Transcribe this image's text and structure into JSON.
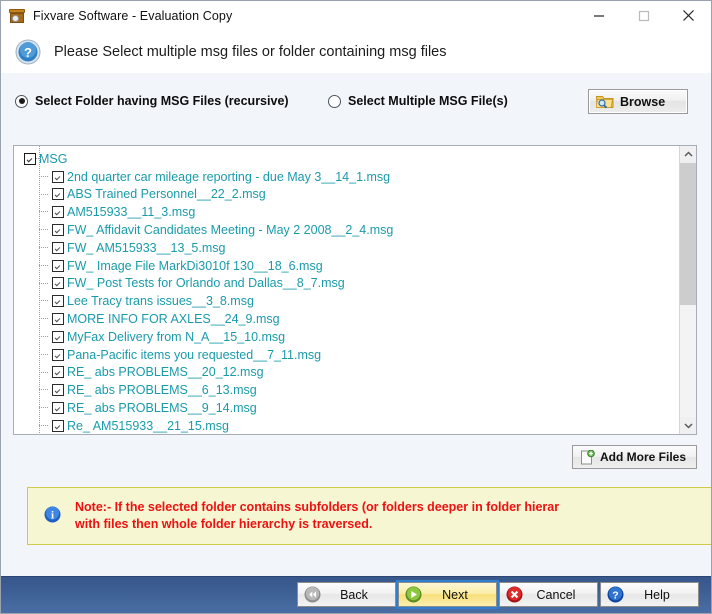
{
  "window": {
    "title": "Fixvare Software - Evaluation Copy",
    "app_icon": "trashcan-icon",
    "controls": {
      "minimize": "minimize-icon",
      "maximize": "maximize-icon",
      "close": "close-icon"
    }
  },
  "header": {
    "icon": "question-help-icon",
    "text": "Please Select multiple msg files or folder containing msg files"
  },
  "options": {
    "folder_radio": {
      "label": "Select Folder having MSG Files (recursive)",
      "selected": true
    },
    "files_radio": {
      "label": "Select Multiple MSG File(s)",
      "selected": false
    },
    "browse_button": {
      "label": "Browse",
      "icon": "folder-search-icon"
    }
  },
  "tree": {
    "root": {
      "label": "MSG",
      "checked": true,
      "expanded": true
    },
    "items": [
      {
        "label": "2nd quarter car mileage reporting - due May 3__14_1.msg",
        "checked": true
      },
      {
        "label": "ABS Trained Personnel__22_2.msg",
        "checked": true
      },
      {
        "label": "AM515933__11_3.msg",
        "checked": true
      },
      {
        "label": "FW_ Affidavit Candidates Meeting - May 2 2008__2_4.msg",
        "checked": true
      },
      {
        "label": "FW_ AM515933__13_5.msg",
        "checked": true
      },
      {
        "label": "FW_ Image File MarkDi3010f 130__18_6.msg",
        "checked": true
      },
      {
        "label": "FW_ Post Tests for Orlando and Dallas__8_7.msg",
        "checked": true
      },
      {
        "label": "Lee Tracy trans issues__3_8.msg",
        "checked": true
      },
      {
        "label": "MORE INFO FOR AXLES__24_9.msg",
        "checked": true
      },
      {
        "label": "MyFax Delivery from N_A__15_10.msg",
        "checked": true
      },
      {
        "label": "Pana-Pacific items you requested__7_11.msg",
        "checked": true
      },
      {
        "label": "RE_ abs PROBLEMS__20_12.msg",
        "checked": true
      },
      {
        "label": "RE_ abs PROBLEMS__6_13.msg",
        "checked": true
      },
      {
        "label": "RE_ abs PROBLEMS__9_14.msg",
        "checked": true
      },
      {
        "label": "Re_ AM515933__21_15.msg",
        "checked": true
      }
    ]
  },
  "add_more": {
    "label": "Add More Files",
    "icon": "page-add-icon"
  },
  "note": {
    "icon": "info-icon",
    "line1": "Note:- If the selected folder contains subfolders (or folders deeper in folder hierar",
    "line2": "with files then whole folder hierarchy is traversed."
  },
  "footer": {
    "buttons": [
      {
        "label": "Back",
        "icon": "rewind-icon"
      },
      {
        "label": "Next",
        "icon": "play-icon"
      },
      {
        "label": "Cancel",
        "icon": "cancel-icon"
      },
      {
        "label": "Help",
        "icon": "question-icon"
      }
    ]
  },
  "colors": {
    "tree_text": "#1a9bab",
    "note_text": "#ee1111",
    "note_bg": "#f7f6d2",
    "footer_bg": "#3d5f94",
    "panel_bg": "#f2f5fa"
  }
}
